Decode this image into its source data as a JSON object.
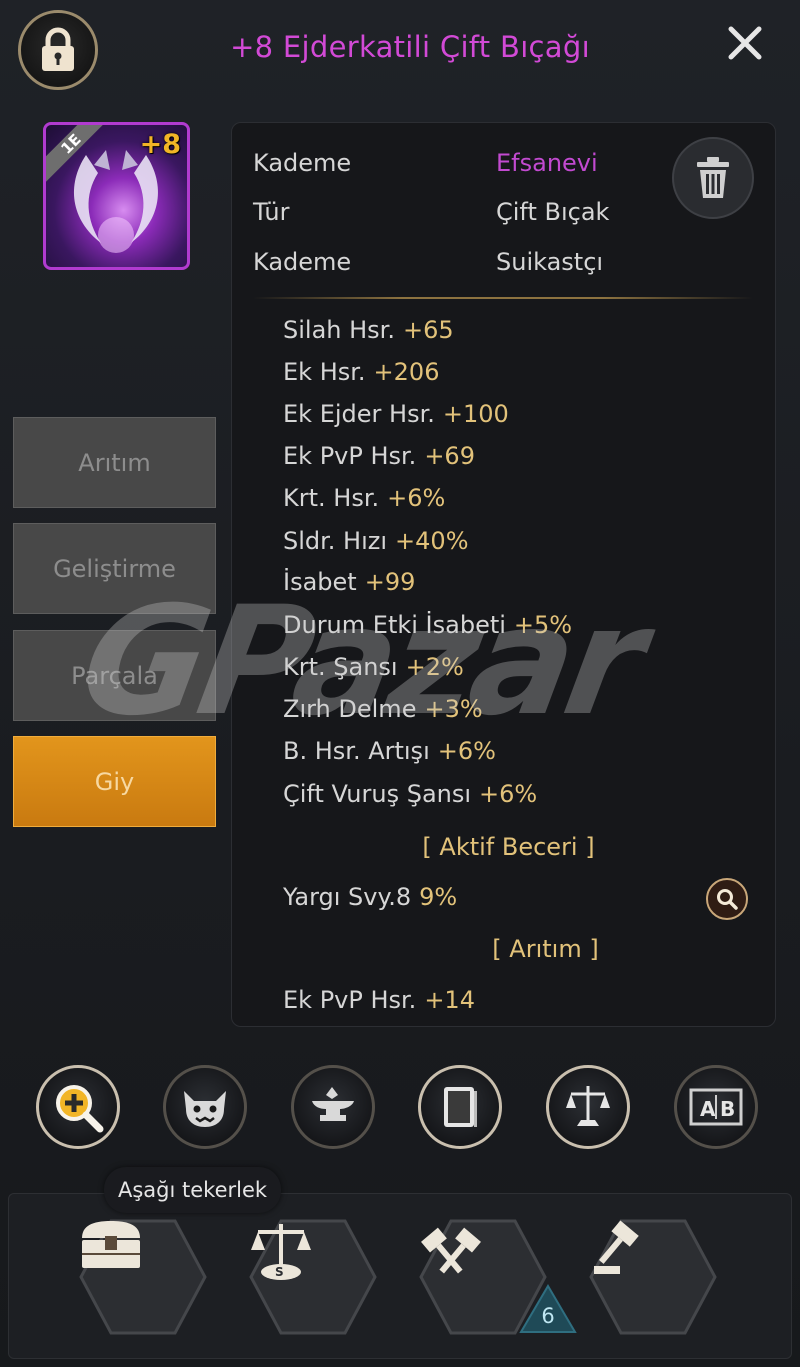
{
  "header": {
    "title": "+8 Ejderkatili Çift Bıçağı",
    "lock_icon": "lock-icon",
    "close_icon": "close-icon"
  },
  "item": {
    "enhance": "+8",
    "tier_tag": "1E",
    "rarity_color": "#b13bd0"
  },
  "actions": {
    "refine": "Arıtım",
    "upgrade": "Geliştirme",
    "dismantle": "Parçala",
    "equip": "Giy"
  },
  "info": {
    "rows": [
      {
        "label": "Kademe",
        "value": "Efsanevi"
      },
      {
        "label": "Tür",
        "value": "Çift Bıçak"
      },
      {
        "label": "Kademe",
        "value": "Suikastçı"
      }
    ]
  },
  "stats": [
    {
      "name": "Silah Hsr.",
      "value": "+65"
    },
    {
      "name": "Ek Hsr.",
      "value": "+206"
    },
    {
      "name": "Ek Ejder Hsr.",
      "value": "+100"
    },
    {
      "name": "Ek PvP Hsr.",
      "value": "+69"
    },
    {
      "name": "Krt. Hsr.",
      "value": "+6%"
    },
    {
      "name": "Sldr. Hızı",
      "value": "+40%"
    },
    {
      "name": "İsabet",
      "value": "+99"
    },
    {
      "name": "Durum Etki İsabeti",
      "value": "+5%"
    },
    {
      "name": "Krt. Şansı",
      "value": "+2%"
    },
    {
      "name": "Zırh Delme",
      "value": "+3%"
    },
    {
      "name": "B. Hsr. Artışı",
      "value": "+6%"
    },
    {
      "name": "Çift Vuruş Şansı",
      "value": "+6%"
    }
  ],
  "active_skill": {
    "header": "[ Aktif Beceri ]",
    "name": "Yargı Svy.8",
    "value": "9%"
  },
  "refine_section": {
    "header": "[ Arıtım ]",
    "name": "Ek PvP Hsr.",
    "value": "+14"
  },
  "watermark": "GPazar",
  "toolbar": {
    "icons": [
      "zoom-plus-icon",
      "demon-face-icon",
      "anvil-icon",
      "book-icon",
      "scales-icon",
      "ab-compare-icon"
    ]
  },
  "bottom": {
    "tooltip": "Aşağı tekerlek",
    "badge_count": "6",
    "icons": [
      "treasure-chest-icon",
      "scales-icon",
      "hammers-icon",
      "gavel-icon"
    ]
  },
  "colors": {
    "title": "#d24ad6",
    "legendary": "#c24ad0",
    "stat_value": "#e2c27a",
    "equip_button": "#e2951c"
  }
}
